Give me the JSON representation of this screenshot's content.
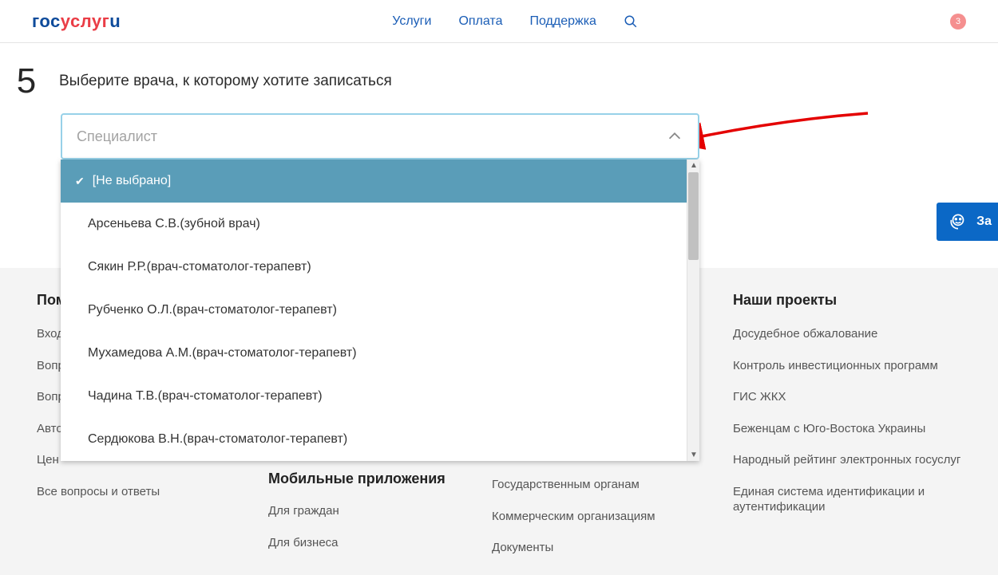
{
  "header": {
    "logo": {
      "p1": "гос",
      "p2": "услуг",
      "p3": "u"
    },
    "nav": {
      "services": "Услуги",
      "payment": "Оплата",
      "support": "Поддержка"
    },
    "notif_count": "3"
  },
  "step": {
    "number": "5",
    "title": "Выберите врача, к которому хотите записаться"
  },
  "select": {
    "placeholder": "Специалист",
    "options": [
      "[Не выбрано]",
      "Арсеньева С.В.(зубной врач)",
      "Сякин Р.Р.(врач-стоматолог-терапевт)",
      "Рубченко О.Л.(врач-стоматолог-терапевт)",
      "Мухамедова А.М.(врач-стоматолог-терапевт)",
      "Чадина Т.В.(врач-стоматолог-терапевт)",
      "Сердюкова В.Н.(врач-стоматолог-терапевт)"
    ]
  },
  "footer": {
    "col1": {
      "heading_visible": "Пом",
      "links": [
        "Вход",
        "Вопр",
        "Вопр",
        "Авто",
        "Цен",
        "Все вопросы и ответы"
      ]
    },
    "col2": {
      "heading": "Мобильные приложения",
      "links": [
        "Для граждан",
        "Для бизнеса"
      ]
    },
    "col3": {
      "links": [
        "Государственным органам",
        "Коммерческим организациям",
        "Документы"
      ]
    },
    "col4": {
      "heading": "Наши проекты",
      "links": [
        "Досудебное обжалование",
        "Контроль инвестиционных программ",
        "ГИС ЖКХ",
        "Беженцам с Юго-Востока Украины",
        "Народный рейтинг электронных госуслуг",
        "Единая система идентификации и аутентификации"
      ]
    }
  },
  "side_button_fragment": "За"
}
